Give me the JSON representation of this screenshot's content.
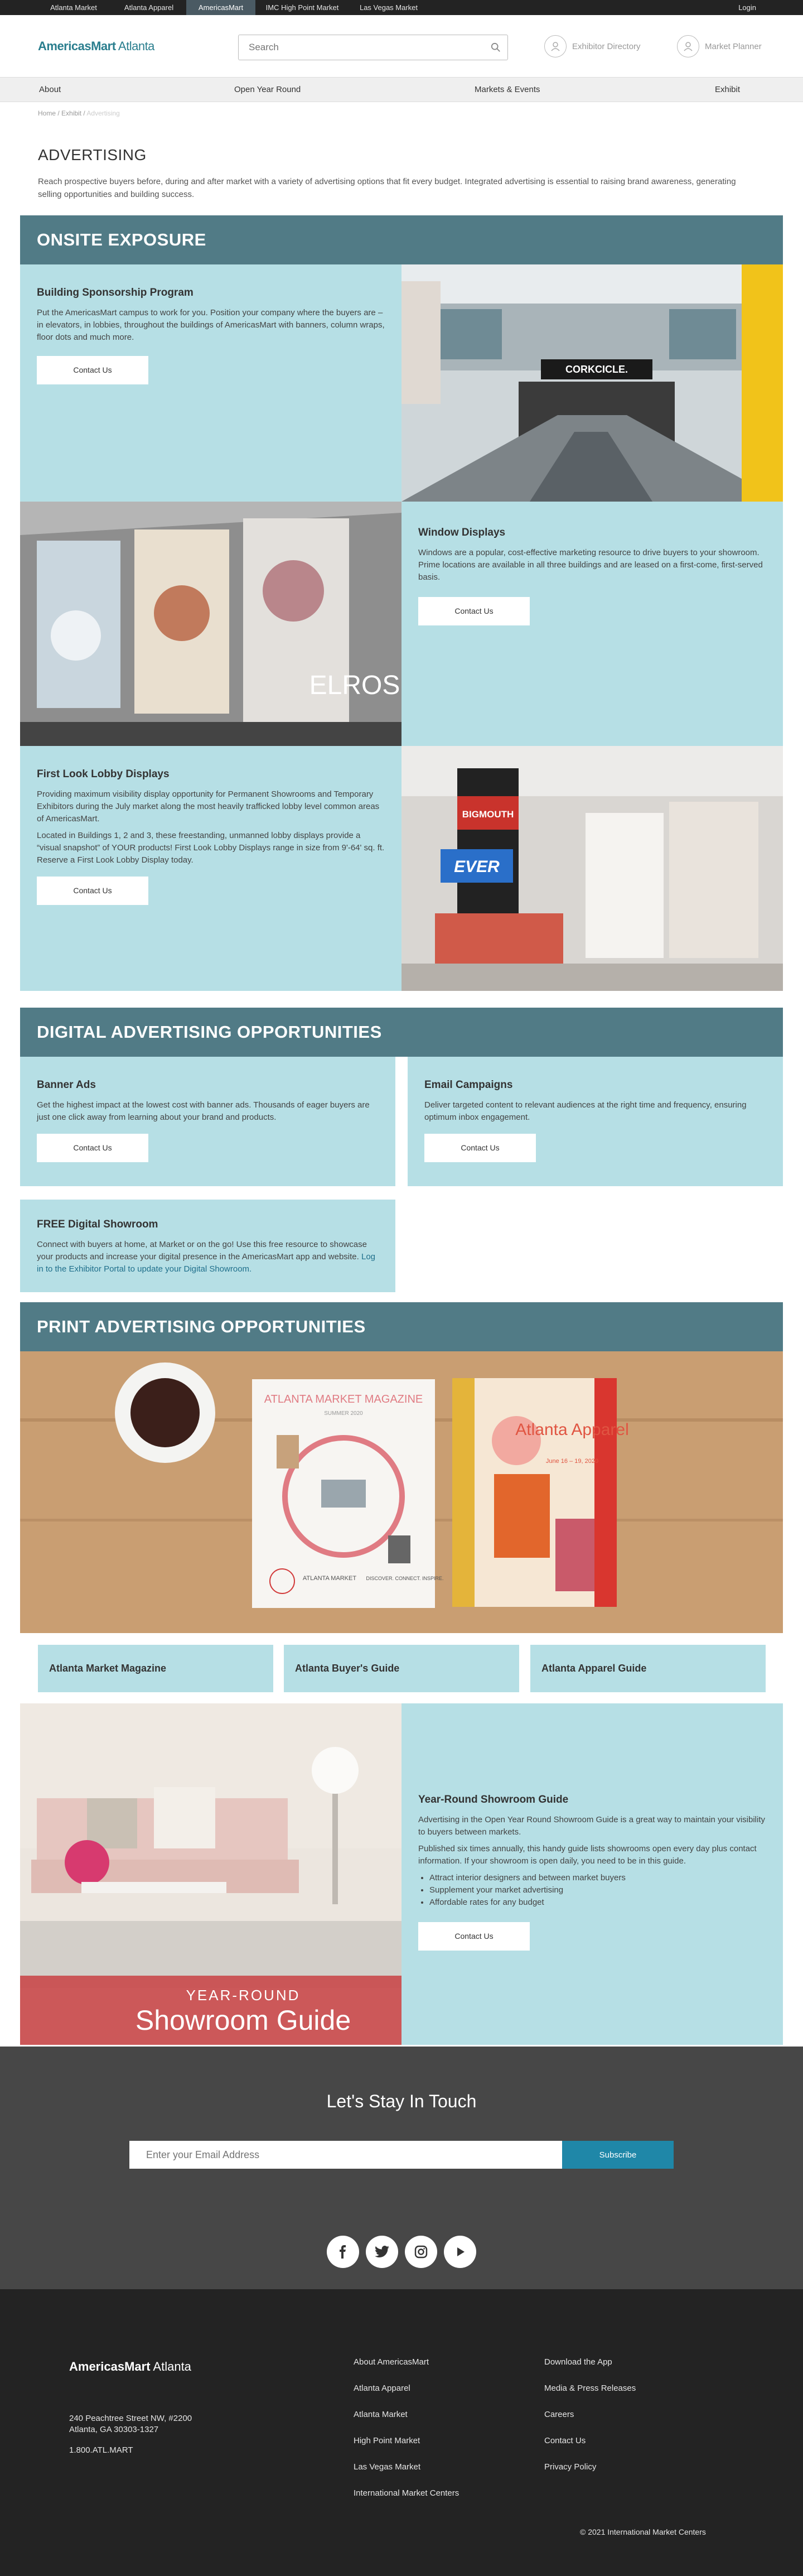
{
  "topbar": {
    "tabs": [
      "Atlanta Market",
      "Atlanta Apparel",
      "AmericasMart",
      "IMC High Point Market",
      "Las Vegas Market"
    ],
    "login": "Login"
  },
  "header": {
    "logo": "AmericasMart",
    "logo_city": "Atlanta",
    "search_placeholder": "Search",
    "exhibitor_directory": "Exhibitor Directory",
    "market_planner": "Market Planner"
  },
  "nav": [
    "About",
    "Open Year Round",
    "Markets & Events",
    "Exhibit"
  ],
  "breadcrumb": [
    "Home",
    "Exhibit",
    "Advertising"
  ],
  "page": {
    "title": "ADVERTISING",
    "intro": "Reach prospective buyers before, during and after market with a variety of advertising options that fit every budget. Integrated advertising is essential to raising brand awareness, generating selling opportunities and building success."
  },
  "onsite": {
    "heading": "ONSITE EXPOSURE",
    "building": {
      "title": "Building Sponsorship Program",
      "text": "Put the AmericasMart campus to work for you. Position your company where the buyers are – in elevators, in lobbies, throughout the buildings of AmericasMart with banners, column wraps, floor dots and much more.",
      "button": "Contact Us",
      "banner_text": "CORKCICLE."
    },
    "windows": {
      "title": "Window Displays",
      "text": "Windows are a popular, cost-effective marketing resource to drive buyers to your showroom. Prime locations are available in all three buildings and are leased on a first-come, first-served basis.",
      "button": "Contact Us",
      "sign_text": "ELROS"
    },
    "lobby": {
      "title": "First Look Lobby Displays",
      "text1": "Providing maximum visibility display opportunity for Permanent Showrooms and Temporary Exhibitors during the July market along the most heavily trafficked lobby level common areas of AmericasMart.",
      "text2": "Located in Buildings 1, 2 and 3, these freestanding, unmanned lobby displays provide a “visual snapshot” of YOUR products! First Look Lobby Displays range in size from 9'-64' sq. ft. Reserve a First Look Lobby Display today.",
      "button": "Contact Us",
      "sign1": "BIGMOUTH",
      "sign2": "EVER"
    }
  },
  "digital": {
    "heading": "DIGITAL ADVERTISING OPPORTUNITIES",
    "banner": {
      "title": "Banner Ads",
      "text": "Get the highest impact at the lowest cost with banner ads. Thousands of eager buyers are just one click away from learning about your brand and products.",
      "button": "Contact Us"
    },
    "email": {
      "title": "Email Campaigns",
      "text": "Deliver targeted content to relevant audiences at the right time and frequency, ensuring optimum inbox engagement.",
      "button": "Contact Us"
    },
    "showroom": {
      "title": "FREE Digital Showroom",
      "text": "Connect with buyers at home, at Market or on the go! Use this free resource to showcase your products and increase your digital presence in the AmericasMart app and website.",
      "link": "Log in to the Exhibitor Portal to update your Digital Showroom."
    }
  },
  "print": {
    "heading": "PRINT ADVERTISING OPPORTUNITIES",
    "mag1_title": "ATLANTA MARKET MAGAZINE",
    "mag1_sub": "SUMMER 2020",
    "mag1_brand": "ATLANTA MARKET",
    "mag1_tag": "DISCOVER. CONNECT. INSPIRE.",
    "mag2_title": "Atlanta Apparel",
    "mag2_date": "June 16 – 19, 2020",
    "guides": [
      "Atlanta Market Magazine",
      "Atlanta Buyer's Guide",
      "Atlanta Apparel Guide"
    ],
    "yearround": {
      "title": "Year-Round Showroom Guide",
      "text1": "Advertising in the Open Year Round Showroom Guide is a great way to maintain your visibility to buyers between markets.",
      "text2": "Published six times annually, this handy guide lists showrooms open every day plus contact information. If your showroom is open daily, you need to be in this guide.",
      "bullets": [
        "Attract interior designers and between market buyers",
        "Supplement your market advertising",
        "Affordable rates for any budget"
      ],
      "button": "Contact Us",
      "img_line1": "YEAR-ROUND",
      "img_line2": "Showroom Guide"
    }
  },
  "newsletter": {
    "heading": "Let's Stay In Touch",
    "placeholder": "Enter your Email Address",
    "button": "Subscribe"
  },
  "footer": {
    "logo": "AmericasMart",
    "logo_city": "Atlanta",
    "address1": "240 Peachtree Street NW, #2200",
    "address2": "Atlanta, GA 30303-1327",
    "phone": "1.800.ATL.MART",
    "col1": [
      "About AmericasMart",
      "Atlanta Apparel",
      "Atlanta Market",
      "High Point Market",
      "Las Vegas Market",
      "International Market Centers"
    ],
    "col2": [
      "Download the App",
      "Media & Press Releases",
      "Careers",
      "Contact Us",
      "Privacy Policy"
    ],
    "copyright": "© 2021 International Market Centers"
  },
  "colors": {
    "accent_teal": "#517b86",
    "panel": "#b6dfe5",
    "subscribe": "#1f87a8"
  }
}
